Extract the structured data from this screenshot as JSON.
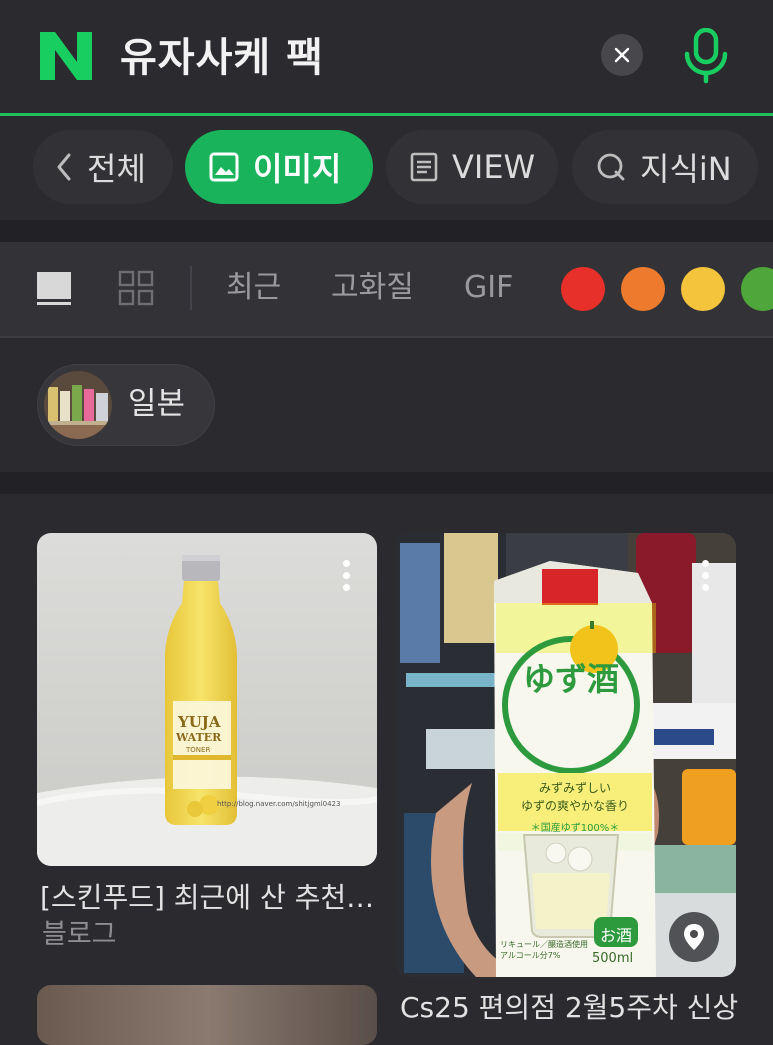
{
  "search": {
    "query": "유자사케 팩"
  },
  "tabs": [
    {
      "label": "전체"
    },
    {
      "label": "이미지"
    },
    {
      "label": "VIEW"
    },
    {
      "label": "지식iN"
    }
  ],
  "filters": {
    "recent": "최근",
    "hq": "고화질",
    "gif": "GIF",
    "colors": [
      "#e8302a",
      "#ee7a2d",
      "#f5c43d",
      "#4fa63a"
    ]
  },
  "related_chip": {
    "label": "일본"
  },
  "results": [
    {
      "title": "[스킨푸드] 최근에 산 추천…",
      "source": "블로그",
      "watermark": "http://blog.naver.com/shitjgml0423"
    },
    {
      "title": "Cs25 편의점 2월5주차 신상"
    }
  ],
  "bottle_label": {
    "line1": "YUJA",
    "line2": "WATER",
    "line3": "TONER"
  },
  "pack_label": {
    "logo": "ゆず酒",
    "tagline1": "みずみずしい",
    "tagline2": "ゆずの爽やかな香り",
    "badge": "＊国産ゆず100%＊",
    "sake_badge": "お酒",
    "volume": "500ml",
    "fine_print": "リキュール／醸造酒使用 アルコール分7%"
  }
}
